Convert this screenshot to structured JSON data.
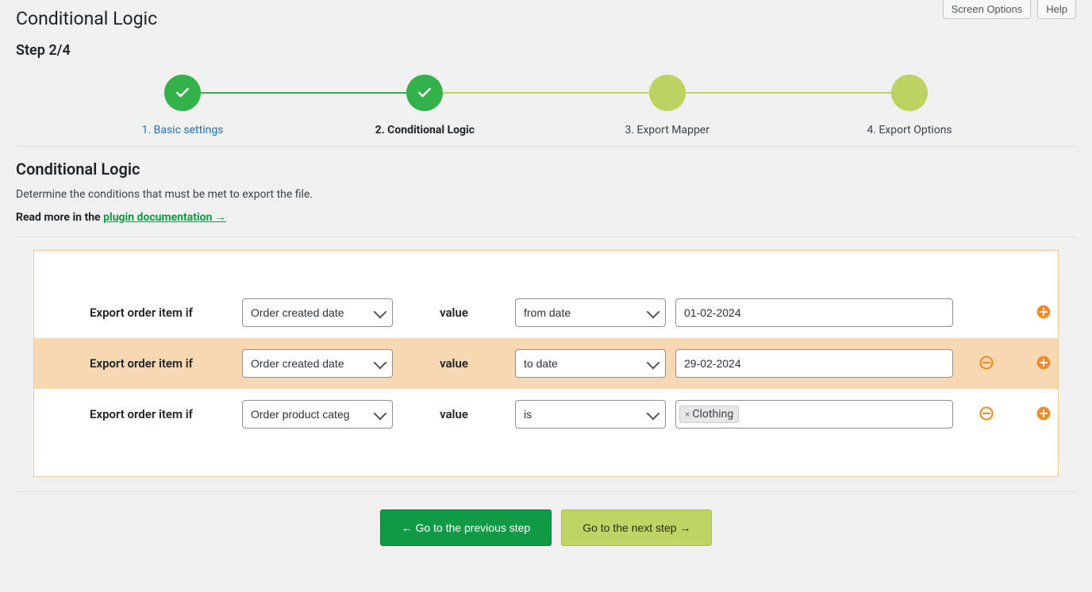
{
  "header": {
    "title": "Conditional Logic",
    "screen_options": "Screen Options",
    "help": "Help"
  },
  "step_indicator": "Step 2/4",
  "steps": [
    {
      "label": "1. Basic settings",
      "state": "done-link"
    },
    {
      "label": "2. Conditional Logic",
      "state": "active"
    },
    {
      "label": "3. Export Mapper",
      "state": "pending"
    },
    {
      "label": "4. Export Options",
      "state": "pending"
    }
  ],
  "section": {
    "title": "Conditional Logic",
    "description": "Determine the conditions that must be met to export the file.",
    "readmore_prefix": "Read more in the ",
    "readmore_link": "plugin documentation →"
  },
  "row_label": "Export order item if",
  "value_label": "value",
  "conditions": [
    {
      "field": "Order created date",
      "operator": "from date",
      "value": "01-02-2024",
      "highlight": false,
      "show_remove": false,
      "show_add": true,
      "value_type": "text"
    },
    {
      "field": "Order created date",
      "operator": "to date",
      "value": "29-02-2024",
      "highlight": true,
      "show_remove": true,
      "show_add": true,
      "value_type": "text"
    },
    {
      "field": "Order product categ",
      "operator": "is",
      "value": "Clothing",
      "highlight": false,
      "show_remove": true,
      "show_add": true,
      "value_type": "tag"
    }
  ],
  "footer": {
    "prev": "← Go to the previous step",
    "next": "Go to the next step →"
  },
  "colors": {
    "accent_green": "#119a46",
    "accent_lime": "#bdd565",
    "orange": "#f08a24"
  }
}
